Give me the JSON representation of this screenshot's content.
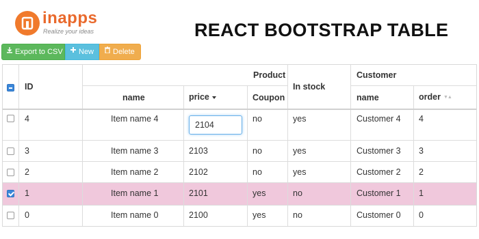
{
  "brand": {
    "name": "inapps",
    "tagline": "Realize your ideas",
    "color": "#e9692c"
  },
  "page_title": "REACT BOOTSTRAP TABLE",
  "toolbar": {
    "export_label": "Export to CSV",
    "new_label": "New",
    "delete_label": "Delete",
    "export_icon": "export-icon",
    "new_icon": "plus-icon",
    "delete_icon": "trash-icon"
  },
  "table": {
    "group_headers": {
      "product": "Product",
      "customer": "Customer",
      "in_stock": "In stock",
      "id": "ID"
    },
    "columns": {
      "name": "name",
      "price": "price",
      "coupon": "Coupon",
      "customer_name": "name",
      "order": "order"
    },
    "editing_value": "2104",
    "rows": [
      {
        "id": "4",
        "name": "Item name 4",
        "price": "2104",
        "coupon": "no",
        "in_stock": "yes",
        "customer": "Customer 4",
        "order": "4",
        "selected": false
      },
      {
        "id": "3",
        "name": "Item name 3",
        "price": "2103",
        "coupon": "no",
        "in_stock": "yes",
        "customer": "Customer 3",
        "order": "3",
        "selected": false
      },
      {
        "id": "2",
        "name": "Item name 2",
        "price": "2102",
        "coupon": "no",
        "in_stock": "yes",
        "customer": "Customer 2",
        "order": "2",
        "selected": false
      },
      {
        "id": "1",
        "name": "Item name 1",
        "price": "2101",
        "coupon": "yes",
        "in_stock": "no",
        "customer": "Customer 1",
        "order": "1",
        "selected": true
      },
      {
        "id": "0",
        "name": "Item name 0",
        "price": "2100",
        "coupon": "yes",
        "in_stock": "no",
        "customer": "Customer 0",
        "order": "0",
        "selected": false
      }
    ],
    "selected_row_color": "#f0c8dc"
  }
}
